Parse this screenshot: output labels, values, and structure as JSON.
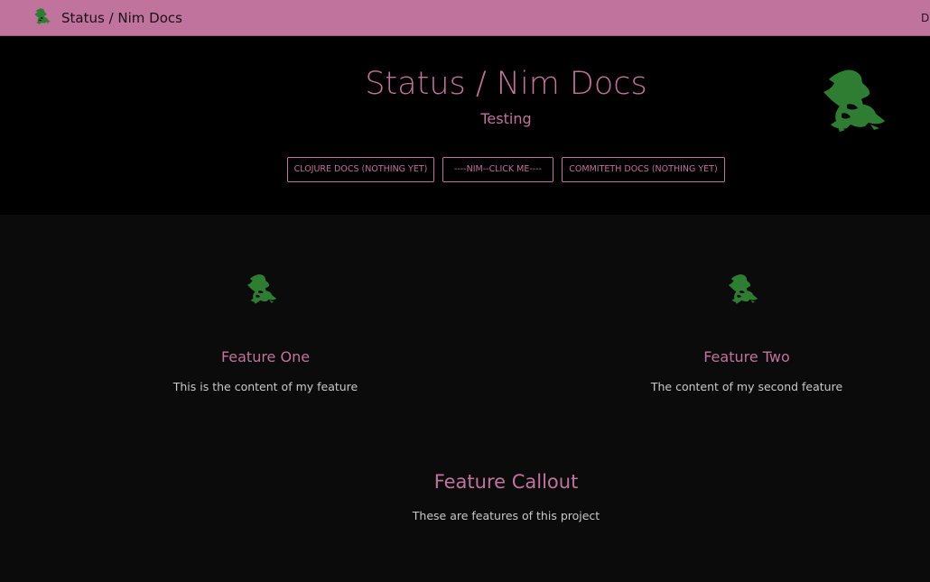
{
  "navbar": {
    "title": "Status / Nim Docs",
    "right_link": "D",
    "logo_icon": "witch-logo-icon"
  },
  "hero": {
    "title": "Status / Nim Docs",
    "subtitle": "Testing",
    "logo_icon": "witch-logo-icon",
    "buttons": [
      {
        "label": "CLOJURE DOCS (NOTHING YET)"
      },
      {
        "label": "----NIM--CLICK ME----"
      },
      {
        "label": "COMMITETH DOCS (NOTHING YET)"
      }
    ]
  },
  "features": [
    {
      "title": "Feature One",
      "text": "This is the content of my feature",
      "icon": "witch-logo-icon"
    },
    {
      "title": "Feature Two",
      "text": "The content of my second feature",
      "icon": "witch-logo-icon"
    }
  ],
  "callout": {
    "title": "Feature Callout",
    "text": "These are features of this project"
  },
  "colors": {
    "accent": "#c0739c",
    "logo_green": "#2e7d32",
    "hero_bg": "#000000",
    "page_bg": "#0b0b0b",
    "body_text": "#c9c9c9"
  }
}
